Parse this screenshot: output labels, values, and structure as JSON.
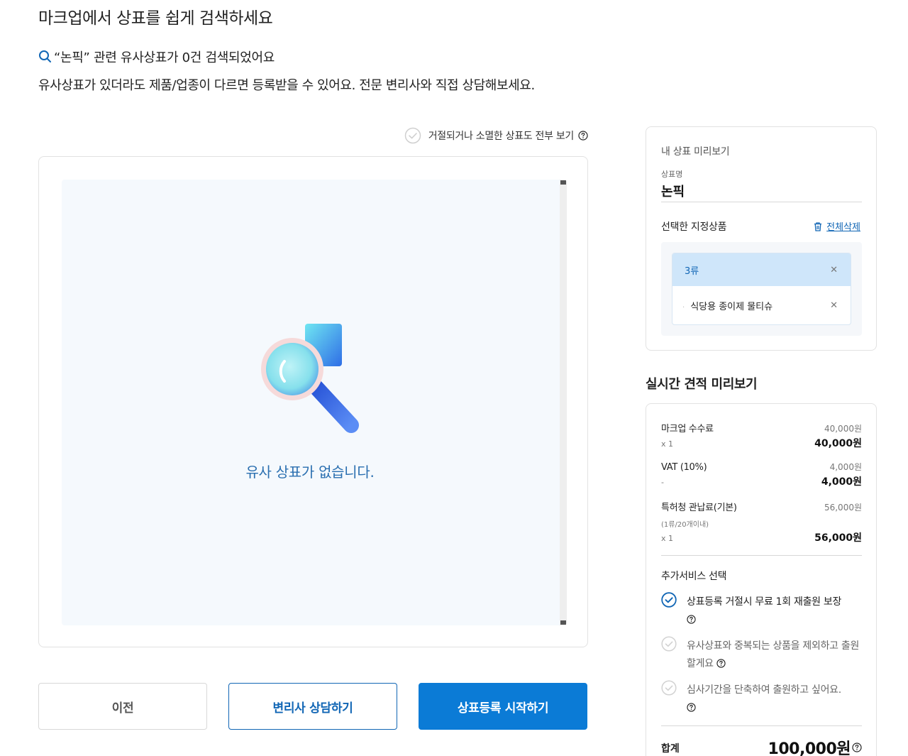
{
  "page": {
    "title": "마크업에서 상표를 쉽게 검색하세요",
    "result_text": "“논픽” 관련 유사상표가 0건 검색되었어요",
    "sub_text": "유사상표가 있더라도 제품/업종이 다르면 등록받을 수 있어요. 전문 변리사와 직접 상담해보세요."
  },
  "filter": {
    "show_all_label": "거절되거나 소멸한 상표도 전부 보기",
    "checked": false
  },
  "results": {
    "empty_message": "유사 상표가 없습니다."
  },
  "buttons": {
    "prev": "이전",
    "consult": "변리사 상담하기",
    "start": "상표등록 시작하기"
  },
  "preview": {
    "title": "내 상표 미리보기",
    "name_label": "상표명",
    "name": "논픽",
    "goods_label": "선택한 지정상품",
    "delete_all": "전체삭제",
    "classes": [
      {
        "label": "3류",
        "items": [
          "식당용 종이제 물티슈"
        ]
      }
    ]
  },
  "estimate": {
    "title": "실시간 견적 미리보기",
    "fees": [
      {
        "name": "마크업 수수료",
        "unit": "40,000원",
        "qty": "x 1",
        "total": "40,000원"
      },
      {
        "name": "VAT (10%)",
        "unit": "4,000원",
        "qty": "-",
        "total": "4,000원"
      },
      {
        "name": "특허청 관납료(기본)",
        "note": "(1류/20개이내)",
        "unit": "56,000원",
        "qty": "x 1",
        "total": "56,000원"
      }
    ],
    "services_title": "추가서비스 선택",
    "services": [
      {
        "label": "상표등록 거절시 무료 1회 재출원 보장",
        "checked": true
      },
      {
        "label": "유사상표와 중복되는 상품을 제외하고 출원할게요",
        "checked": false
      },
      {
        "label": "심사기간을 단축하여 출원하고 싶어요.",
        "checked": false
      }
    ],
    "sum_label": "합계",
    "sum_value": "100,000원"
  },
  "colors": {
    "primary": "#0b7bd6",
    "link": "#1166b5",
    "class_header_bg": "#cfe6fa",
    "results_bg": "#f5f9fd"
  }
}
